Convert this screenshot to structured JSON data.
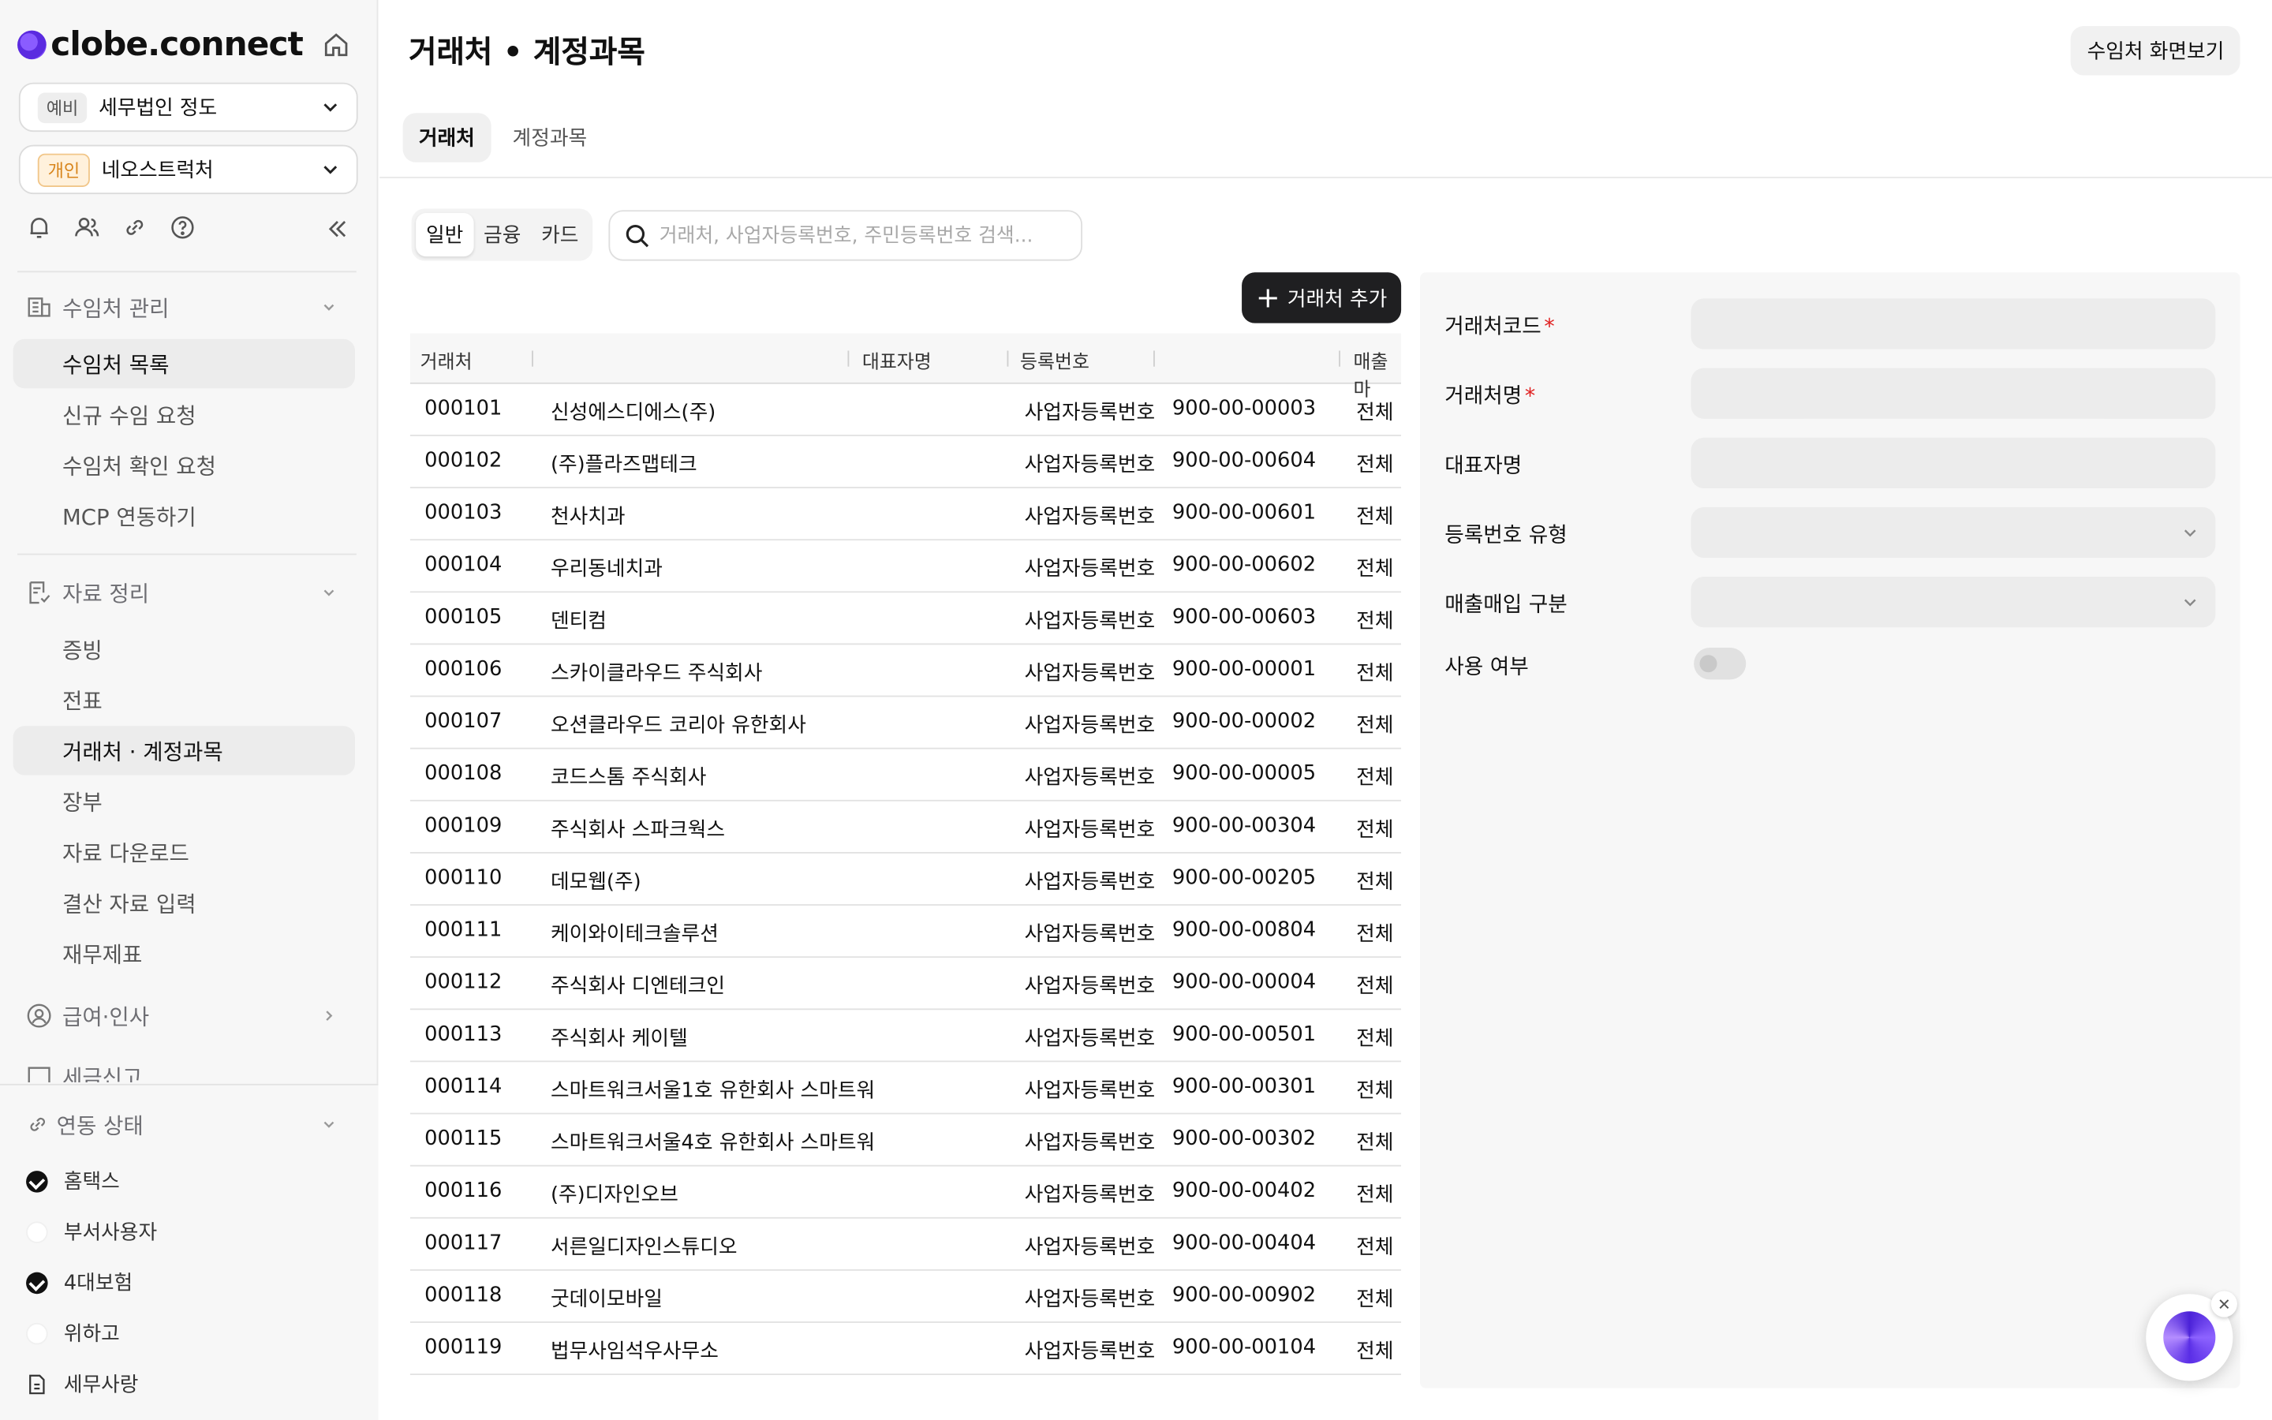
{
  "brand": {
    "name": "clobe.connect"
  },
  "org_select": {
    "chip": "예비",
    "value": "세무법인 정도"
  },
  "client_select": {
    "chip": "개인",
    "value": "네오스트럭처"
  },
  "sidebar": {
    "sections": [
      {
        "title": "수임처 관리",
        "items": [
          "수임처 목록",
          "신규 수임 요청",
          "수임처 확인 요청",
          "MCP 연동하기"
        ]
      },
      {
        "title": "자료 정리",
        "items": [
          "증빙",
          "전표",
          "거래처 · 계정과목",
          "장부",
          "자료 다운로드",
          "결산 자료 입력",
          "재무제표"
        ]
      },
      {
        "title": "급여·인사"
      },
      {
        "title": "세금신고"
      }
    ],
    "status_title": "연동 상태",
    "status_items": [
      {
        "label": "홈택스",
        "connected": true
      },
      {
        "label": "부서사용자",
        "connected": false
      },
      {
        "label": "4대보험",
        "connected": true
      },
      {
        "label": "위하고",
        "connected": false
      },
      {
        "label": "세무사랑",
        "icon": "file-icon"
      }
    ]
  },
  "page": {
    "title": "거래처 • 계정과목",
    "top_button": "수임처 화면보기",
    "tabs": [
      "거래처",
      "계정과목"
    ],
    "filters": [
      "일반",
      "금융",
      "카드"
    ],
    "search_placeholder": "거래처, 사업자등록번호, 주민등록번호 검색...",
    "add_button": "거래처 추가"
  },
  "table": {
    "headers": [
      "거래처",
      "대표자명",
      "등록번호",
      "매출마"
    ],
    "rows": [
      [
        "000101",
        "신성에스디에스(주)",
        "사업자등록번호",
        "900-00-00003",
        "전체"
      ],
      [
        "000102",
        "(주)플라즈맵테크",
        "사업자등록번호",
        "900-00-00604",
        "전체"
      ],
      [
        "000103",
        "천사치과",
        "사업자등록번호",
        "900-00-00601",
        "전체"
      ],
      [
        "000104",
        "우리동네치과",
        "사업자등록번호",
        "900-00-00602",
        "전체"
      ],
      [
        "000105",
        "덴티컴",
        "사업자등록번호",
        "900-00-00603",
        "전체"
      ],
      [
        "000106",
        "스카이클라우드 주식회사",
        "사업자등록번호",
        "900-00-00001",
        "전체"
      ],
      [
        "000107",
        "오션클라우드 코리아 유한회사",
        "사업자등록번호",
        "900-00-00002",
        "전체"
      ],
      [
        "000108",
        "코드스톰 주식회사",
        "사업자등록번호",
        "900-00-00005",
        "전체"
      ],
      [
        "000109",
        "주식회사 스파크웍스",
        "사업자등록번호",
        "900-00-00304",
        "전체"
      ],
      [
        "000110",
        "데모웹(주)",
        "사업자등록번호",
        "900-00-00205",
        "전체"
      ],
      [
        "000111",
        "케이와이테크솔루션",
        "사업자등록번호",
        "900-00-00804",
        "전체"
      ],
      [
        "000112",
        "주식회사 디엔테크인",
        "사업자등록번호",
        "900-00-00004",
        "전체"
      ],
      [
        "000113",
        "주식회사 케이텔",
        "사업자등록번호",
        "900-00-00501",
        "전체"
      ],
      [
        "000114",
        "스마트워크서울1호 유한회사 스마트워",
        "사업자등록번호",
        "900-00-00301",
        "전체"
      ],
      [
        "000115",
        "스마트워크서울4호 유한회사 스마트워",
        "사업자등록번호",
        "900-00-00302",
        "전체"
      ],
      [
        "000116",
        "(주)디자인오브",
        "사업자등록번호",
        "900-00-00402",
        "전체"
      ],
      [
        "000117",
        "서른일디자인스튜디오",
        "사업자등록번호",
        "900-00-00404",
        "전체"
      ],
      [
        "000118",
        "굿데이모바일",
        "사업자등록번호",
        "900-00-00902",
        "전체"
      ],
      [
        "000119",
        "법무사임석우사무소",
        "사업자등록번호",
        "900-00-00104",
        "전체"
      ]
    ]
  },
  "detail": {
    "fields": [
      {
        "label": "거래처코드",
        "required": true,
        "type": "text",
        "value": ""
      },
      {
        "label": "거래처명",
        "required": true,
        "type": "text",
        "value": ""
      },
      {
        "label": "대표자명",
        "required": false,
        "type": "text",
        "value": ""
      },
      {
        "label": "등록번호 유형",
        "required": false,
        "type": "select",
        "value": ""
      },
      {
        "label": "매출매입 구분",
        "required": false,
        "type": "select",
        "value": ""
      }
    ],
    "toggle_label": "사용 여부",
    "toggle_on": false
  },
  "colors": {
    "primary_button": "#1f1f21",
    "required_mark": "#e02020",
    "brand_purple": "#6b3df0"
  }
}
